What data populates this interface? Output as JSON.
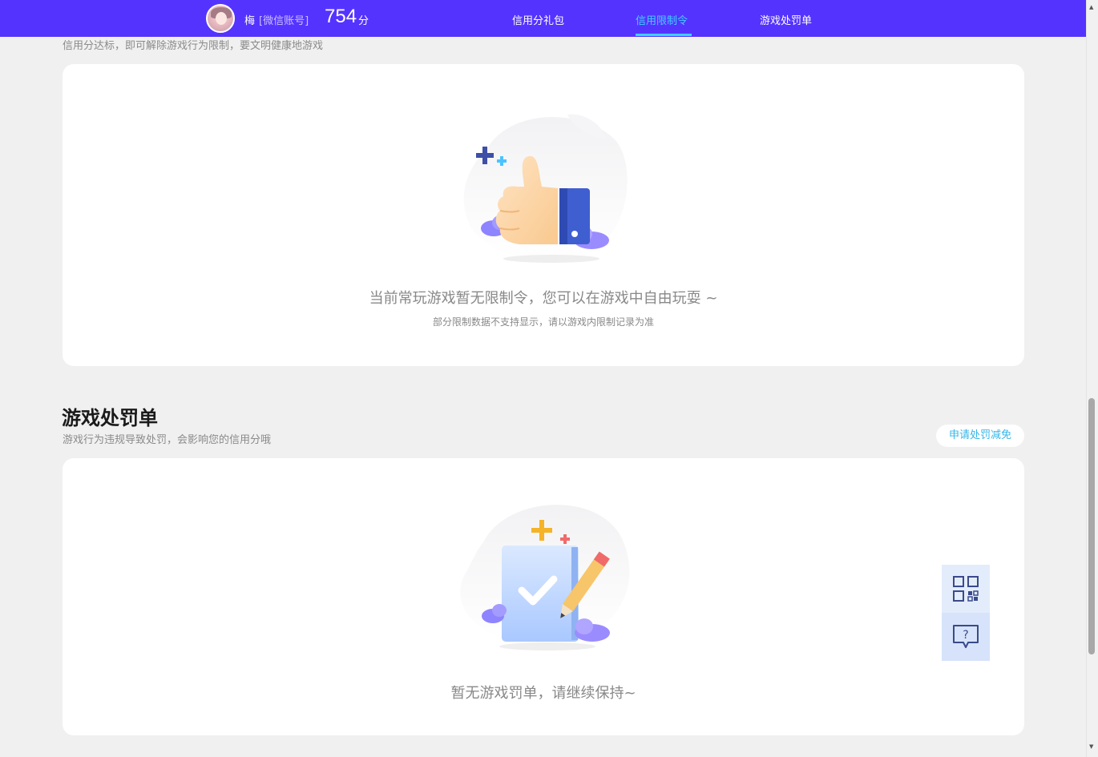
{
  "header": {
    "user_name": "梅",
    "account_type": "[微信账号]",
    "score": "754",
    "score_unit": "分",
    "nav": [
      {
        "label": "信用分礼包",
        "active": false
      },
      {
        "label": "信用限制令",
        "active": true
      },
      {
        "label": "游戏处罚单",
        "active": false
      }
    ]
  },
  "restriction_section": {
    "description": "信用分达标，即可解除游戏行为限制，要文明健康地游戏",
    "empty_main": "当前常玩游戏暂无限制令，您可以在游戏中自由玩耍 ~",
    "empty_sub": "部分限制数据不支持显示，请以游戏内限制记录为准"
  },
  "penalty_section": {
    "title": "游戏处罚单",
    "description": "游戏行为违规导致处罚，会影响您的信用分哦",
    "apply_button": "申请处罚减免",
    "empty_main": "暂无游戏罚单，请继续保持~"
  },
  "float_panel": {
    "icons": [
      "qr-code-icon",
      "help-chat-icon"
    ],
    "help_glyph": "?"
  },
  "colors": {
    "brand": "#5533ff",
    "nav_active": "#3fd0ff",
    "link": "#35b6e8",
    "background": "#f0f0f0"
  }
}
